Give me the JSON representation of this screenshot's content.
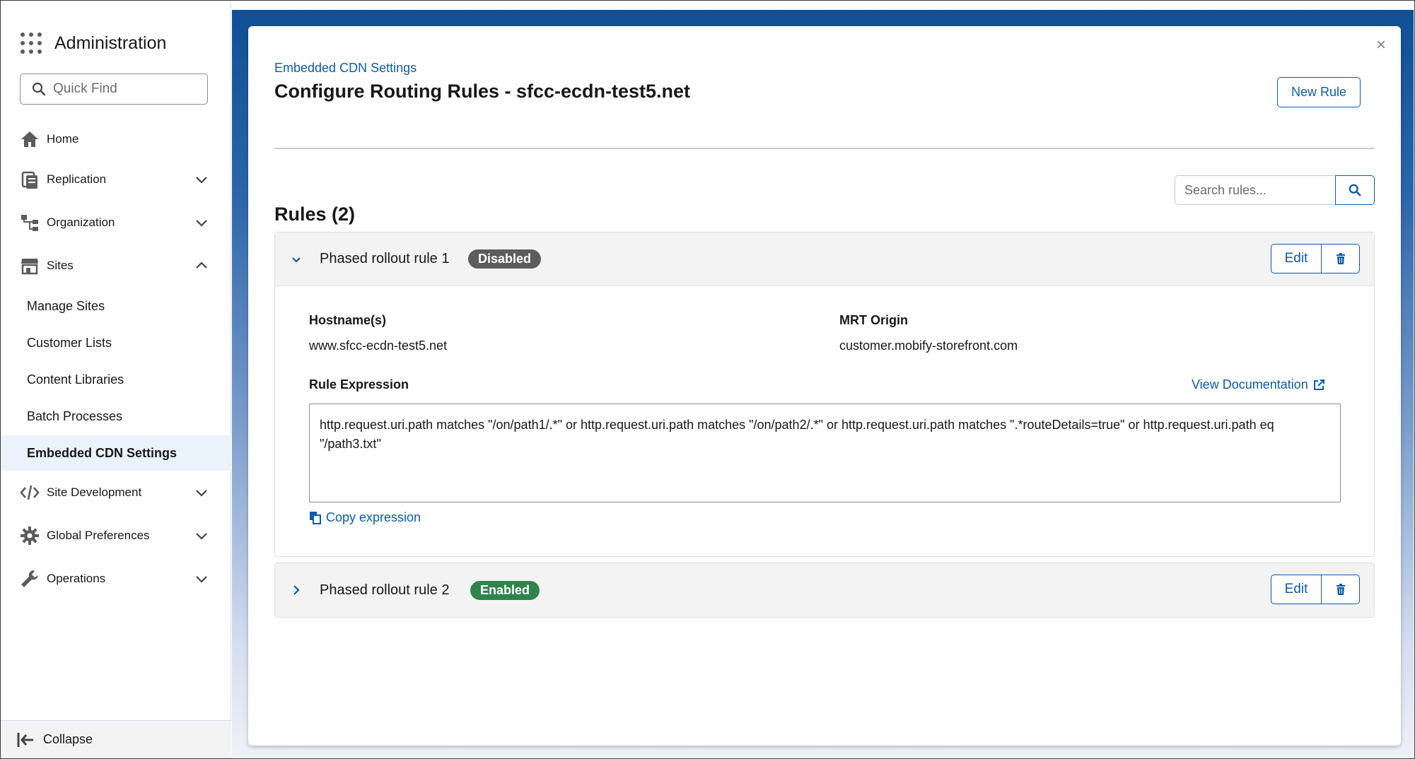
{
  "sidebar": {
    "title": "Administration",
    "quick_find_placeholder": "Quick Find",
    "nav": [
      {
        "label": "Home",
        "icon": "home-icon"
      },
      {
        "label": "Replication",
        "icon": "replication-icon"
      },
      {
        "label": "Organization",
        "icon": "organization-icon"
      },
      {
        "label": "Sites",
        "icon": "store-icon"
      }
    ],
    "sites_sub": [
      {
        "label": "Manage Sites"
      },
      {
        "label": "Customer Lists"
      },
      {
        "label": "Content Libraries"
      },
      {
        "label": "Batch Processes"
      },
      {
        "label": "Embedded CDN Settings",
        "active": true
      }
    ],
    "nav_after": [
      {
        "label": "Site Development",
        "icon": "code-icon"
      },
      {
        "label": "Global Preferences",
        "icon": "gear-icon"
      },
      {
        "label": "Operations",
        "icon": "wrench-icon"
      }
    ],
    "collapse_label": "Collapse"
  },
  "modal": {
    "breadcrumb": "Embedded CDN Settings",
    "title": "Configure Routing Rules - sfcc-ecdn-test5.net",
    "new_rule_label": "New Rule",
    "close_label": "×",
    "rules_heading": "Rules (2)",
    "search_placeholder": "Search rules...",
    "rules": [
      {
        "name": "Phased rollout rule 1",
        "status": "Disabled",
        "expanded": true,
        "edit_label": "Edit",
        "hostname_label": "Hostname(s)",
        "hostname_value": "www.sfcc-ecdn-test5.net",
        "origin_label": "MRT Origin",
        "origin_value": "customer.mobify-storefront.com",
        "expression_label": "Rule Expression",
        "doc_link": "View Documentation",
        "expression": "http.request.uri.path matches \"/on/path1/.*\" or http.request.uri.path matches \"/on/path2/.*\" or http.request.uri.path matches \".*routeDetails=true\" or http.request.uri.path eq \"/path3.txt\"",
        "copy_label": "Copy expression"
      },
      {
        "name": "Phased rollout rule 2",
        "status": "Enabled",
        "expanded": false,
        "edit_label": "Edit"
      }
    ]
  },
  "colors": {
    "brand_blue": "#0b5cab",
    "badge_disabled": "#5c5c5c",
    "badge_enabled": "#2e844a",
    "active_nav_bg": "#eaf2fb"
  }
}
